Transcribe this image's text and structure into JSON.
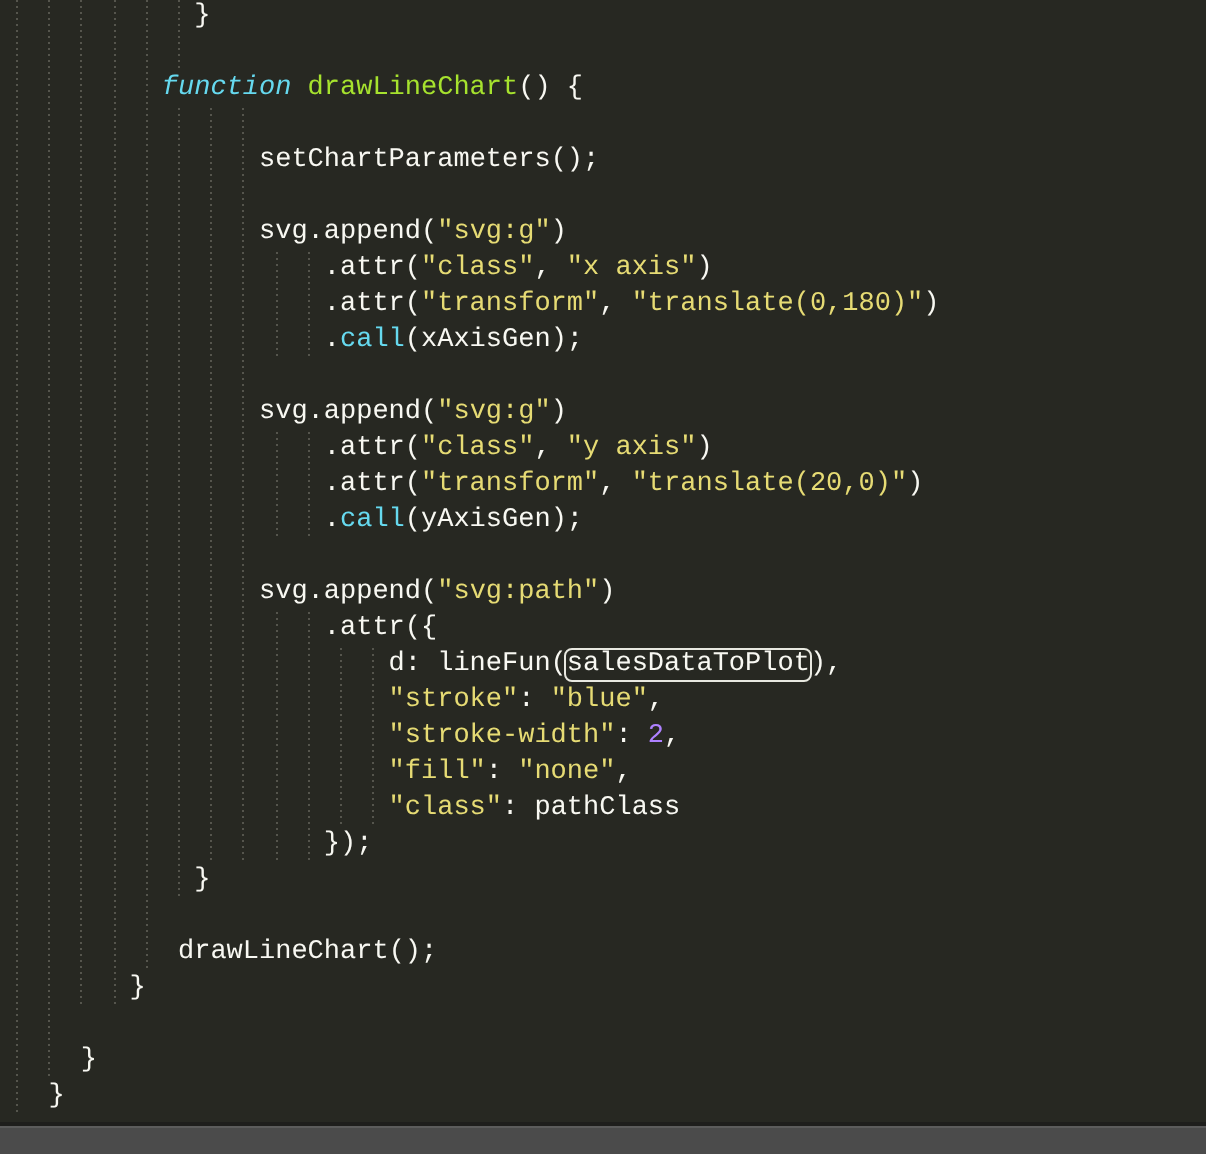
{
  "editor": {
    "blocks": [
      {
        "lines": [
          {
            "tokens": [
              {
                "text": "}",
                "kind": "plain"
              }
            ]
          }
        ]
      },
      {
        "lines": [
          {
            "tokens": [
              {
                "text": "function",
                "kind": "keyword"
              },
              {
                "text": "drawLineChart",
                "kind": "entity"
              },
              {
                "text": "() {",
                "kind": "plain"
              }
            ]
          }
        ]
      },
      {
        "lines": [
          {
            "tokens": [
              {
                "text": "setChartParameters();",
                "kind": "plain"
              }
            ]
          }
        ]
      },
      {
        "lines": [
          {
            "tokens": [
              {
                "text": "svg.append(",
                "kind": "plain"
              },
              {
                "text": "\"svg:g\"",
                "kind": "string"
              },
              {
                "text": ")",
                "kind": "plain"
              }
            ]
          },
          {
            "tokens": [
              {
                "text": ".attr(",
                "kind": "plain"
              },
              {
                "text": "\"class\"",
                "kind": "string"
              },
              {
                "text": ",",
                "kind": "plain"
              },
              {
                "text": "\"x axis\"",
                "kind": "string"
              },
              {
                "text": ")",
                "kind": "plain"
              }
            ]
          },
          {
            "tokens": [
              {
                "text": ".attr(",
                "kind": "plain"
              },
              {
                "text": "\"transform\"",
                "kind": "string"
              },
              {
                "text": ",",
                "kind": "plain"
              },
              {
                "text": "\"translate(0,180)\"",
                "kind": "string"
              },
              {
                "text": ")",
                "kind": "plain"
              }
            ]
          },
          {
            "tokens": [
              {
                "text": ".",
                "kind": "plain"
              },
              {
                "text": "call",
                "kind": "support"
              },
              {
                "text": "(xAxisGen);",
                "kind": "plain"
              }
            ]
          }
        ]
      },
      {
        "lines": [
          {
            "tokens": [
              {
                "text": "svg.append(",
                "kind": "plain"
              },
              {
                "text": "\"svg:g\"",
                "kind": "string"
              },
              {
                "text": ")",
                "kind": "plain"
              }
            ]
          },
          {
            "tokens": [
              {
                "text": ".attr(",
                "kind": "plain"
              },
              {
                "text": "\"class\"",
                "kind": "string"
              },
              {
                "text": ",",
                "kind": "plain"
              },
              {
                "text": "\"y axis\"",
                "kind": "string"
              },
              {
                "text": ")",
                "kind": "plain"
              }
            ]
          },
          {
            "tokens": [
              {
                "text": ".attr(",
                "kind": "plain"
              },
              {
                "text": "\"transform\"",
                "kind": "string"
              },
              {
                "text": ",",
                "kind": "plain"
              },
              {
                "text": "\"translate(20,0)\"",
                "kind": "string"
              },
              {
                "text": ")",
                "kind": "plain"
              }
            ]
          },
          {
            "tokens": [
              {
                "text": ".",
                "kind": "plain"
              },
              {
                "text": "call",
                "kind": "support"
              },
              {
                "text": "(yAxisGen);",
                "kind": "plain"
              }
            ]
          }
        ]
      },
      {
        "lines": [
          {
            "tokens": [
              {
                "text": "svg.append(",
                "kind": "plain"
              },
              {
                "text": "\"svg:path\"",
                "kind": "string"
              },
              {
                "text": ")",
                "kind": "plain"
              }
            ]
          },
          {
            "tokens": [
              {
                "text": ".attr({",
                "kind": "plain"
              }
            ]
          },
          {
            "tokens": [
              {
                "text": "d: lineFun(",
                "kind": "plain"
              },
              {
                "text": "salesDataToPlot",
                "kind": "highlighted"
              },
              {
                "text": "),",
                "kind": "plain"
              }
            ]
          },
          {
            "tokens": [
              {
                "text": "\"stroke\"",
                "kind": "string"
              },
              {
                "text": ":",
                "kind": "plain"
              },
              {
                "text": "\"blue\"",
                "kind": "string"
              },
              {
                "text": ",",
                "kind": "plain"
              }
            ]
          },
          {
            "tokens": [
              {
                "text": "\"stroke-width\"",
                "kind": "string"
              },
              {
                "text": ":",
                "kind": "plain"
              },
              {
                "text": "2",
                "kind": "number"
              },
              {
                "text": ",",
                "kind": "plain"
              }
            ]
          },
          {
            "tokens": [
              {
                "text": "\"fill\"",
                "kind": "string"
              },
              {
                "text": ":",
                "kind": "plain"
              },
              {
                "text": "\"none\"",
                "kind": "string"
              },
              {
                "text": ",",
                "kind": "plain"
              }
            ]
          },
          {
            "tokens": [
              {
                "text": "\"class\"",
                "kind": "string"
              },
              {
                "text": ": pathClass",
                "kind": "plain"
              }
            ]
          },
          {
            "tokens": [
              {
                "text": "});",
                "kind": "plain"
              }
            ]
          },
          {
            "tokens": [
              {
                "text": "}",
                "kind": "plain"
              }
            ]
          }
        ]
      },
      {
        "lines": [
          {
            "tokens": [
              {
                "text": "drawLineChart();",
                "kind": "plain"
              }
            ]
          },
          {
            "tokens": [
              {
                "text": "}",
                "kind": "plain"
              }
            ]
          }
        ]
      },
      {
        "lines": [
          {
            "tokens": [
              {
                "text": "}",
                "kind": "plain"
              }
            ]
          },
          {
            "tokens": [
              {
                "text": "}",
                "kind": "plain"
              }
            ]
          }
        ]
      }
    ]
  }
}
